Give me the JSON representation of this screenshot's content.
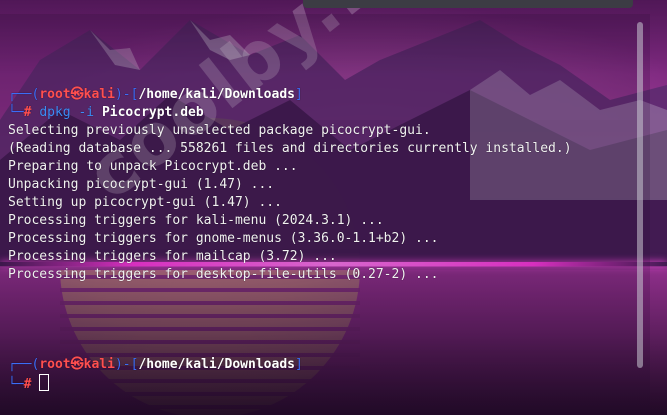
{
  "watermark": "coolby.net",
  "colors": {
    "prompt_box": "#3c6cf6",
    "prompt_user": "#ff4f4f",
    "command": "#3c8cf6",
    "output": "#f2f2f2",
    "horizon_glow": "#ff38e0"
  },
  "terminal": {
    "prompt1": {
      "corner_top": "┌──(",
      "user": "root",
      "at": "㉿",
      "host": "kali",
      "mid": ")-[",
      "path": "/home/kali/Downloads",
      "end": "]",
      "corner_bottom": "└─",
      "symbol": "#",
      "command": "dpkg",
      "flag": "-i",
      "argument": "Picocrypt.deb"
    },
    "output": [
      "Selecting previously unselected package picocrypt-gui.",
      "(Reading database ... 558261 files and directories currently installed.)",
      "Preparing to unpack Picocrypt.deb ...",
      "Unpacking picocrypt-gui (1.47) ...",
      "Setting up picocrypt-gui (1.47) ...",
      "Processing triggers for kali-menu (2024.3.1) ...",
      "Processing triggers for gnome-menus (3.36.0-1.1+b2) ...",
      "Processing triggers for mailcap (3.72) ...",
      "Processing triggers for desktop-file-utils (0.27-2) ..."
    ],
    "prompt2": {
      "corner_top": "┌──(",
      "user": "root",
      "at": "㉿",
      "host": "kali",
      "mid": ")-[",
      "path": "/home/kali/Downloads",
      "end": "]",
      "corner_bottom": "└─",
      "symbol": "#"
    }
  }
}
